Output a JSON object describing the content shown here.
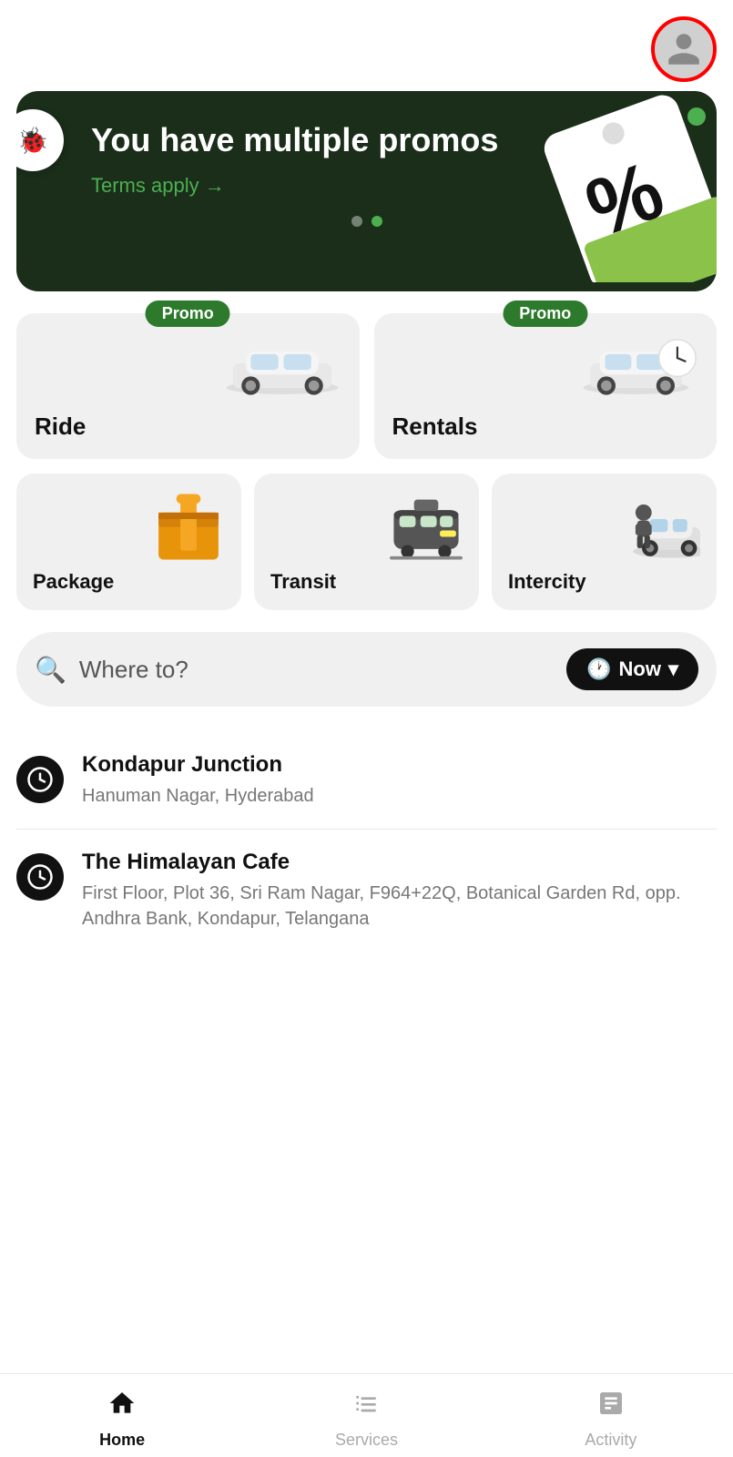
{
  "header": {
    "profile_label": "profile"
  },
  "banner": {
    "title": "You have multiple promos",
    "terms": "Terms apply →",
    "dot1_active": false,
    "dot2_active": true
  },
  "services_top": [
    {
      "id": "ride",
      "label": "Ride",
      "badge": "Promo",
      "has_badge": true
    },
    {
      "id": "rentals",
      "label": "Rentals",
      "badge": "Promo",
      "has_badge": true
    }
  ],
  "services_bottom": [
    {
      "id": "package",
      "label": "Package"
    },
    {
      "id": "transit",
      "label": "Transit"
    },
    {
      "id": "intercity",
      "label": "Intercity"
    }
  ],
  "search": {
    "placeholder": "Where to?",
    "time_label": "Now"
  },
  "recent_locations": [
    {
      "name": "Kondapur Junction",
      "address": "Hanuman Nagar, Hyderabad"
    },
    {
      "name": "The Himalayan Cafe",
      "address": "First Floor, Plot 36, Sri Ram Nagar, F964+22Q, Botanical Garden Rd, opp. Andhra Bank, Kondapur, Telangana"
    }
  ],
  "bottom_nav": [
    {
      "id": "home",
      "label": "Home",
      "active": true
    },
    {
      "id": "services",
      "label": "Services",
      "active": false
    },
    {
      "id": "activity",
      "label": "Activity",
      "active": false
    }
  ],
  "colors": {
    "promo_green": "#2d7a2d",
    "banner_bg": "#1a2e1a",
    "accent_green": "#4caf50"
  }
}
